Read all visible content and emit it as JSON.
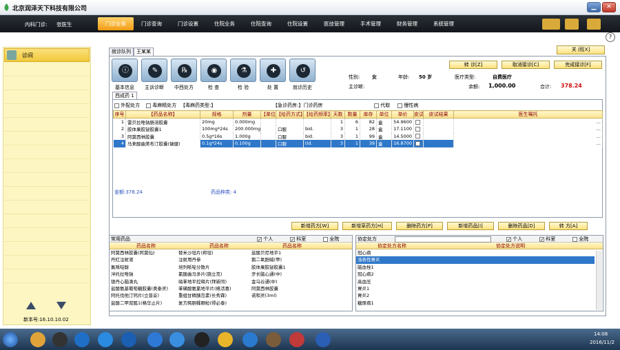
{
  "app": {
    "title": "北京润泽天下科技有限公司"
  },
  "header": {
    "dept": "内科门诊:",
    "doctor": "张医生"
  },
  "menu": [
    "门诊业务",
    "门诊查询",
    "门诊设置",
    "住院业务",
    "住院查询",
    "住院设置",
    "医技管理",
    "手术管理",
    "财务管理",
    "系统管理"
  ],
  "sidebar": {
    "item": "诊间",
    "version": "新本号:16.10.10.02"
  },
  "tabs": [
    "就诊队列",
    "王某某"
  ],
  "close_label": "关 闭[X]",
  "help": "?",
  "tools": [
    "基本信息",
    "主诉诊断",
    "中西处方",
    "检 查",
    "检 验",
    "处 置",
    "就诊历史"
  ],
  "actions": {
    "transfer": "转 诊[Z]",
    "cancel": "取消接诊[C]",
    "finish": "完成接诊[F]"
  },
  "patient": {
    "gender_label": "性别:",
    "gender": "女",
    "age_label": "年龄:",
    "age": "50 岁",
    "type_label": "医疗类型:",
    "type": "自费医疗",
    "diag_label": "主诊断:",
    "balance_label": "余额:",
    "balance": "1,000.00",
    "total_label": "合计:",
    "total": "378.24"
  },
  "rx": {
    "tab": "西成药 1",
    "flags": {
      "external": "外配处方",
      "narcotic": "毒麻精处方",
      "narcotic_type": "【毒麻药类型:】",
      "emergency": "【急诊药房:】门诊药房",
      "proxy": "代取",
      "chronic": "慢性病"
    },
    "columns": [
      "序号",
      "【药品名称】",
      "规格",
      "剂量",
      "【单位】",
      "【给药方式】",
      "【给药频率】",
      "天数",
      "数量",
      "库存",
      "单位",
      "单价",
      "皮试",
      "皮试结果",
      "医生嘱托"
    ],
    "rows": [
      {
        "no": "1",
        "name": "雷贝拉唑钠肠溶胶囊",
        "spec": "20mg",
        "dose": "0.000mg",
        "unit": "",
        "route": "",
        "freq": "",
        "days": "1",
        "qty": "6",
        "stock": "82",
        "sunit": "盒",
        "price": "54.9600",
        "note": "..."
      },
      {
        "no": "2",
        "name": "胶体果胶铋胶囊1",
        "spec": "100mg*24s",
        "dose": "200.000mg",
        "unit": "",
        "route": "口服",
        "freq": "bid.",
        "days": "3",
        "qty": "1",
        "stock": "28",
        "sunit": "盒",
        "price": "17.1100",
        "note": "..."
      },
      {
        "no": "3",
        "name": "阿莫西林胶囊",
        "spec": "0.5g*16s",
        "dose": "1.000g",
        "unit": "",
        "route": "口服",
        "freq": "bid.",
        "days": "3",
        "qty": "1",
        "stock": "99",
        "sunit": "盒",
        "price": "14.5000",
        "note": "..."
      },
      {
        "no": "4",
        "name": "马来酸曲美布汀胶囊(瑞健)",
        "spec": "0.1g*24s",
        "dose": "0.100g",
        "unit": "",
        "route": "口服",
        "freq": "tid.",
        "days": "3",
        "qty": "1",
        "stock": "39",
        "sunit": "盒",
        "price": "16.8700",
        "note": "..."
      }
    ],
    "total": "金额:378.24",
    "kinds": "药品种类:  4",
    "buttons": [
      "新增药方[W]",
      "新增草药方[H]",
      "删除药方[P]",
      "新增药品[I]",
      "删除药品[D]",
      "转 方[A]"
    ]
  },
  "common": {
    "title": "常用药品",
    "personal": "个人",
    "dept": "科室",
    "all": "全院",
    "headers": [
      "药品名称",
      "药品名称",
      "药品名称"
    ],
    "rows": [
      [
        "阿莫西林胶囊(阿莫仙)",
        "替米沙坦片(邦坦)",
        "盐酸贝尼地平1"
      ],
      [
        "丹红注射液",
        "注射用丹参",
        "鹅二氧胆碱(甲)"
      ],
      [
        "氟哌啶醇",
        "培列哌啶分散片",
        "胶体果胶铋胶囊1"
      ],
      [
        "泮托拉唑钠",
        "氯酸曲马多片(施立克)",
        "步长脑心通(中)"
      ],
      [
        "银丹心脑滴丸",
        "硝苯地平控释片(拜新同)",
        "金乌谷通(中)"
      ],
      [
        "盐酸氨基葡萄糖胶囊(奥泰灵)",
        "苯磺酸氨氯地平片(络活喜)",
        "阿莫西林胶囊"
      ],
      [
        "阿托伐他汀钙片(立普妥)",
        "重组甘精胰岛素(长秀霖)",
        "诺和灵(3ml)"
      ],
      [
        "盐酸二甲双胍1(格华止片)",
        "复方鳄胆鞣颗粒(得必泰)",
        ""
      ]
    ]
  },
  "protocol": {
    "title": "协定处方",
    "personal": "个人",
    "dept": "科室",
    "all": "全院",
    "headers": [
      "协定处方名称",
      "协定处方说明"
    ],
    "rows": [
      "冠心病",
      "浅表性胃炎",
      "脑血栓1",
      "冠心病2",
      "高血压",
      "胃炎1",
      "胃炎2",
      "糖尿病1"
    ],
    "selected": 1
  },
  "taskbar": {
    "time": "14:08",
    "date": "2016/11/2"
  },
  "colors": {
    "accent": "#f19a13",
    "selection": "#2f78c9",
    "total": "#d01010"
  }
}
